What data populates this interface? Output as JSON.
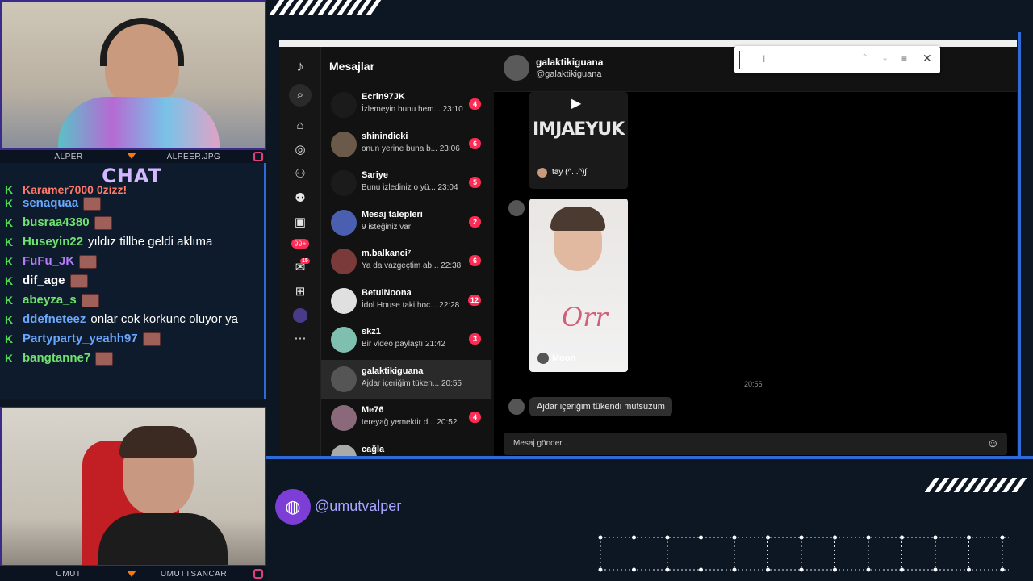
{
  "overlay": {
    "social_handle": "@umutvalper",
    "chat_title": "CHAT"
  },
  "cams": {
    "top": {
      "left_name": "ALPER",
      "right_name": "ALPEER.JPG"
    },
    "bottom": {
      "left_name": "UMUT",
      "right_name": "UMUTTSANCAR"
    }
  },
  "chat": {
    "cutoff_line": "Karamer7000 0zjzz!",
    "messages": [
      {
        "user": "senaquaa",
        "text": "",
        "color": "#6aa8ff",
        "emote": true
      },
      {
        "user": "busraa4380",
        "text": "",
        "color": "#6fe26f",
        "emote": true
      },
      {
        "user": "Huseyin22",
        "text": "yıldız tillbe geldi aklıma",
        "color": "#6fe26f",
        "emote": false
      },
      {
        "user": "FuFu_JK",
        "text": "",
        "color": "#b77bff",
        "emote": true
      },
      {
        "user": "dif_age",
        "text": "",
        "color": "#ffffff",
        "emote": true
      },
      {
        "user": "abeyza_s",
        "text": "",
        "color": "#6fe26f",
        "emote": true
      },
      {
        "user": "ddefneteez",
        "text": "onlar cok korkunc oluyor ya",
        "color": "#6aa8ff",
        "emote": false
      },
      {
        "user": "Partyparty_yeahh97",
        "text": "",
        "color": "#6aa8ff",
        "emote": true
      },
      {
        "user": "bangtanne7",
        "text": "",
        "color": "#6fe26f",
        "emote": true
      }
    ]
  },
  "tiktok": {
    "list_title": "Mesajlar",
    "conversations": [
      {
        "name": "Ecrin97JK",
        "preview": "İzlemeyin bunu hem...",
        "time": "23:10",
        "badge": "4",
        "avatar": "#1b1b1b"
      },
      {
        "name": "shinindicki",
        "preview": "onun yerine buna b...",
        "time": "23:06",
        "badge": "6",
        "avatar": "#6b5a4a"
      },
      {
        "name": "Sariye",
        "preview": "Bunu izlediniz o yü...",
        "time": "23:04",
        "badge": "5",
        "avatar": "#1b1b1b"
      },
      {
        "name": "Mesaj talepleri",
        "preview": "9 isteğiniz var",
        "time": "",
        "badge": "2",
        "avatar": "#4b5fb0"
      },
      {
        "name": "m.balkanci⁷",
        "preview": "Ya da vazgeçtim ab...",
        "time": "22:38",
        "badge": "6",
        "avatar": "#7a3a3a"
      },
      {
        "name": "BetulNoona",
        "preview": "İdol House taki hoc...",
        "time": "22:28",
        "badge": "12",
        "avatar": "#e0e0e0"
      },
      {
        "name": "skz1",
        "preview": "Bir video paylaştı",
        "time": "21:42",
        "badge": "3",
        "avatar": "#7fbfb0"
      },
      {
        "name": "galaktikiguana",
        "preview": "Ajdar içeriğim tüken...",
        "time": "20:55",
        "badge": "",
        "avatar": "#555555"
      },
      {
        "name": "Me76",
        "preview": "tereyağ yemektir d...",
        "time": "20:52",
        "badge": "4",
        "avatar": "#8a6a7a"
      },
      {
        "name": "cağla",
        "preview": "",
        "time": "",
        "badge": "",
        "avatar": "#aaaaaa"
      }
    ],
    "header": {
      "name": "galaktikiguana",
      "handle": "@galaktikiguana"
    },
    "video_cards": [
      {
        "banner_text": "IMJAEYUK",
        "author": "tay (^. .^)ʃ"
      },
      {
        "overlay_text": "Orr",
        "author": "Moon"
      }
    ],
    "timestamp": "20:55",
    "last_message": "Ajdar içeriğim tükendi mutsuzum",
    "input_placeholder": "Mesaj gönder...",
    "rail_badges": {
      "notifications": "99+",
      "messages": "15"
    }
  },
  "colors": {
    "accent": "#fe2c55",
    "frame": "#2f6bd8",
    "chat_title": "#d3b7ff"
  }
}
